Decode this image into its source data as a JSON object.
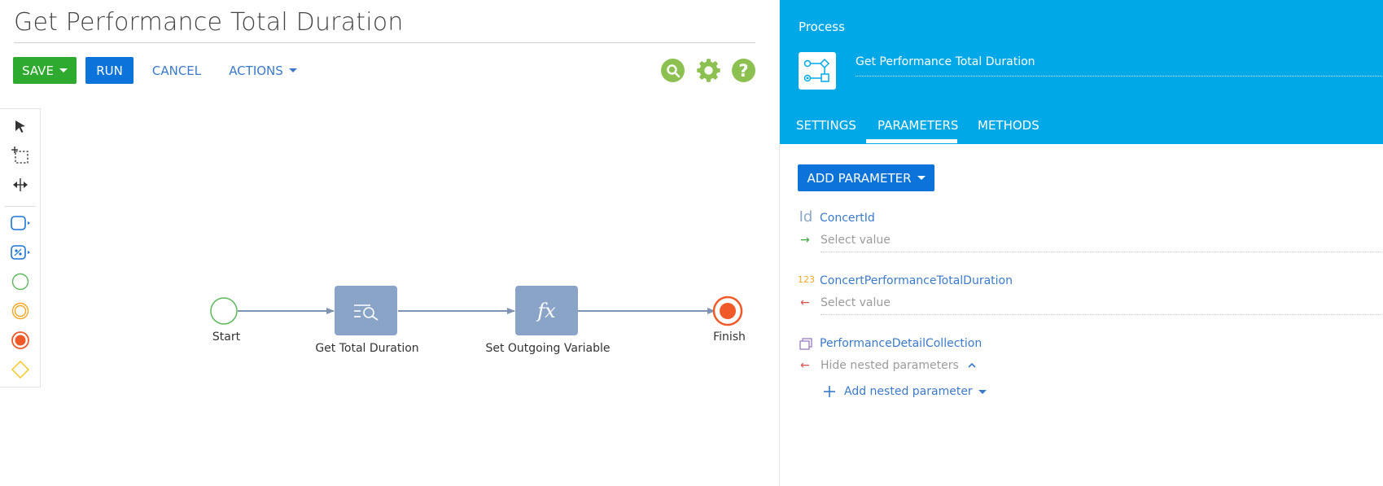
{
  "page": {
    "title": "Get Performance Total Duration"
  },
  "toolbar": {
    "save_label": "SAVE",
    "run_label": "RUN",
    "cancel_label": "CANCEL",
    "actions_label": "ACTIONS"
  },
  "diagram": {
    "start_label": "Start",
    "task1_label": "Get Total Duration",
    "task2_label": "Set Outgoing Variable",
    "task2_icon_text": "fx",
    "finish_label": "Finish"
  },
  "panel": {
    "section_label": "Process",
    "process_name": "Get Performance Total Duration",
    "tabs": [
      {
        "label": "SETTINGS"
      },
      {
        "label": "PARAMETERS",
        "active": true
      },
      {
        "label": "METHODS"
      }
    ],
    "add_parameter_label": "ADD PARAMETER",
    "parameters": [
      {
        "type_icon_text": "Id",
        "name": "ConcertId",
        "direction_symbol": "→",
        "value_placeholder": "Select value"
      },
      {
        "type_icon_text": "123",
        "name": "ConcertPerformanceTotalDuration",
        "direction_symbol": "←",
        "value_placeholder": "Select value"
      },
      {
        "type_icon": "collection-icon",
        "name": "PerformanceDetailCollection",
        "direction_symbol": "←",
        "nested_toggle_label": "Hide nested parameters",
        "add_nested_label": "Add nested parameter"
      }
    ]
  },
  "colors": {
    "header_blue": "#00a8e8",
    "save_green": "#2eab2e",
    "primary_blue": "#0b73d9",
    "task_fill": "#8aa4c8",
    "finish_orange": "#f05a28",
    "link_blue": "#3a7ac9"
  }
}
